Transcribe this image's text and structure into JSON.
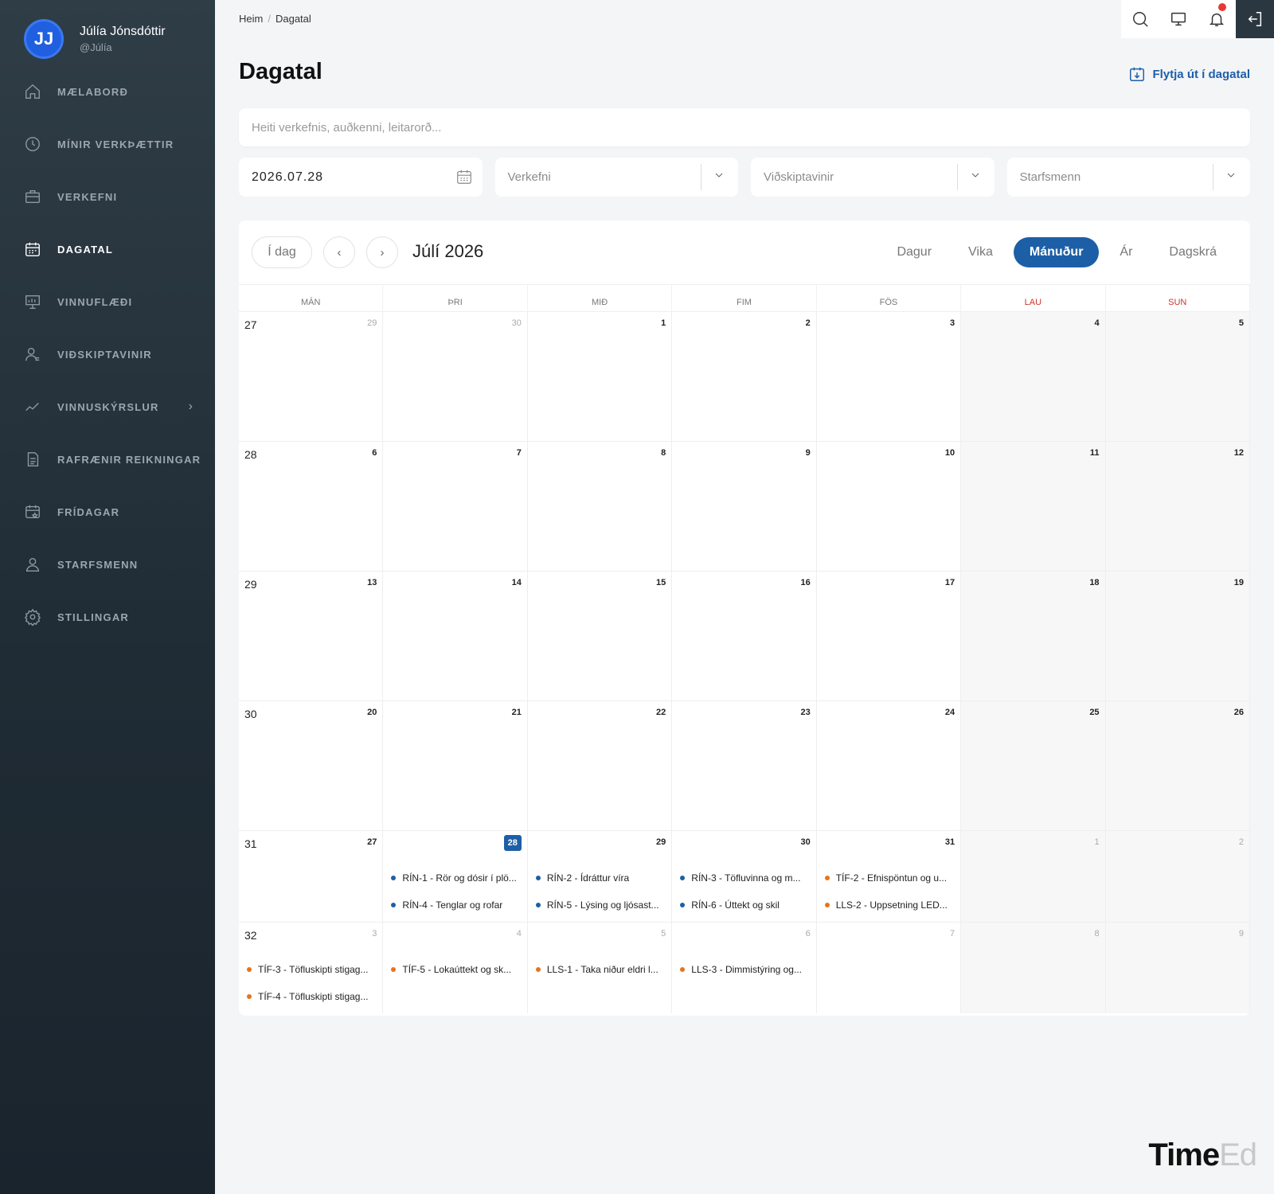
{
  "user": {
    "initials": "JJ",
    "name": "Júlía Jónsdóttir",
    "handle": "@Júlía"
  },
  "nav": [
    {
      "label": "MÆLABORÐ",
      "icon": "home-icon",
      "active": false
    },
    {
      "label": "MÍNIR VERKÞÆTTIR",
      "icon": "clock-icon",
      "active": false
    },
    {
      "label": "VERKEFNI",
      "icon": "briefcase-icon",
      "active": false
    },
    {
      "label": "DAGATAL",
      "icon": "calendar-icon",
      "active": true
    },
    {
      "label": "VINNUFLÆÐI",
      "icon": "board-icon",
      "active": false
    },
    {
      "label": "VIÐSKIPTAVINIR",
      "icon": "client-icon",
      "active": false
    },
    {
      "label": "VINNUSKÝRSLUR",
      "icon": "chart-line-icon",
      "active": false,
      "chevron": "›"
    },
    {
      "label": "RAFRÆNIR REIKNINGAR",
      "icon": "document-icon",
      "active": false
    },
    {
      "label": "FRÍDAGAR",
      "icon": "holiday-calendar-icon",
      "active": false
    },
    {
      "label": "STARFSMENN",
      "icon": "user-icon",
      "active": false
    },
    {
      "label": "STILLINGAR",
      "icon": "gear-icon",
      "active": false
    }
  ],
  "breadcrumb": {
    "home": "Heim",
    "separator": "/",
    "current": "Dagatal"
  },
  "page_title": "Dagatal",
  "export_label": "Flytja út í dagatal",
  "search_placeholder": "Heiti verkefnis, auðkenni, leitarorð...",
  "filters": {
    "date": "2026.07.28",
    "project": "Verkefni",
    "client": "Viðskiptavinir",
    "staff": "Starfsmenn"
  },
  "calendar": {
    "today_label": "Í dag",
    "month_label": "Júlí 2026",
    "views": [
      {
        "label": "Dagur",
        "active": false
      },
      {
        "label": "Vika",
        "active": false
      },
      {
        "label": "Mánuður",
        "active": true
      },
      {
        "label": "Ár",
        "active": false
      },
      {
        "label": "Dagskrá",
        "active": false
      }
    ],
    "weekdays": [
      "MÁN",
      "ÞRI",
      "MIÐ",
      "FIM",
      "FÖS",
      "LAU",
      "SUN"
    ],
    "colors": {
      "blue": "#1d5fa6",
      "orange": "#e8731a"
    },
    "weeks": [
      {
        "week": "27",
        "days": [
          {
            "n": "29",
            "muted": true
          },
          {
            "n": "30",
            "muted": true
          },
          {
            "n": "1"
          },
          {
            "n": "2"
          },
          {
            "n": "3"
          },
          {
            "n": "4"
          },
          {
            "n": "5"
          }
        ]
      },
      {
        "week": "28",
        "days": [
          {
            "n": "6"
          },
          {
            "n": "7"
          },
          {
            "n": "8"
          },
          {
            "n": "9"
          },
          {
            "n": "10"
          },
          {
            "n": "11"
          },
          {
            "n": "12"
          }
        ]
      },
      {
        "week": "29",
        "days": [
          {
            "n": "13"
          },
          {
            "n": "14"
          },
          {
            "n": "15"
          },
          {
            "n": "16"
          },
          {
            "n": "17"
          },
          {
            "n": "18"
          },
          {
            "n": "19"
          }
        ]
      },
      {
        "week": "30",
        "days": [
          {
            "n": "20"
          },
          {
            "n": "21"
          },
          {
            "n": "22"
          },
          {
            "n": "23"
          },
          {
            "n": "24"
          },
          {
            "n": "25"
          },
          {
            "n": "26"
          }
        ]
      },
      {
        "week": "31",
        "days": [
          {
            "n": "27"
          },
          {
            "n": "28",
            "today": true,
            "events": [
              {
                "text": "RÍN-1 - Rör og dósir í plö...",
                "color": "blue"
              },
              {
                "text": "RÍN-4 - Tenglar og rofar",
                "color": "blue"
              }
            ]
          },
          {
            "n": "29",
            "events": [
              {
                "text": "RÍN-2 - Ídráttur víra",
                "color": "blue"
              },
              {
                "text": "RÍN-5 - Lýsing og ljósast...",
                "color": "blue"
              }
            ]
          },
          {
            "n": "30",
            "events": [
              {
                "text": "RÍN-3 - Töfluvinna og m...",
                "color": "blue"
              },
              {
                "text": "RÍN-6 - Úttekt og skil",
                "color": "blue"
              }
            ]
          },
          {
            "n": "31",
            "events": [
              {
                "text": "TÍF-2 - Efnispöntun og u...",
                "color": "orange"
              },
              {
                "text": "LLS-2 - Uppsetning LED...",
                "color": "orange"
              }
            ]
          },
          {
            "n": "1",
            "muted": true
          },
          {
            "n": "2",
            "muted": true
          }
        ]
      },
      {
        "week": "32",
        "days": [
          {
            "n": "3",
            "muted": true,
            "events": [
              {
                "text": "TÍF-3 - Töfluskipti stigag...",
                "color": "orange"
              },
              {
                "text": "TÍF-4 - Töfluskipti stigag...",
                "color": "orange"
              }
            ]
          },
          {
            "n": "4",
            "muted": true,
            "events": [
              {
                "text": "TÍF-5 - Lokaúttekt og sk...",
                "color": "orange"
              }
            ]
          },
          {
            "n": "5",
            "muted": true,
            "events": [
              {
                "text": "LLS-1 - Taka niður eldri l...",
                "color": "orange"
              }
            ]
          },
          {
            "n": "6",
            "muted": true,
            "events": [
              {
                "text": "LLS-3 - Dimmistýring og...",
                "color": "orange"
              }
            ]
          },
          {
            "n": "7",
            "muted": true
          },
          {
            "n": "8",
            "muted": true
          },
          {
            "n": "9",
            "muted": true
          }
        ]
      }
    ]
  },
  "logo": {
    "part1": "Time",
    "part2": "Ed"
  }
}
